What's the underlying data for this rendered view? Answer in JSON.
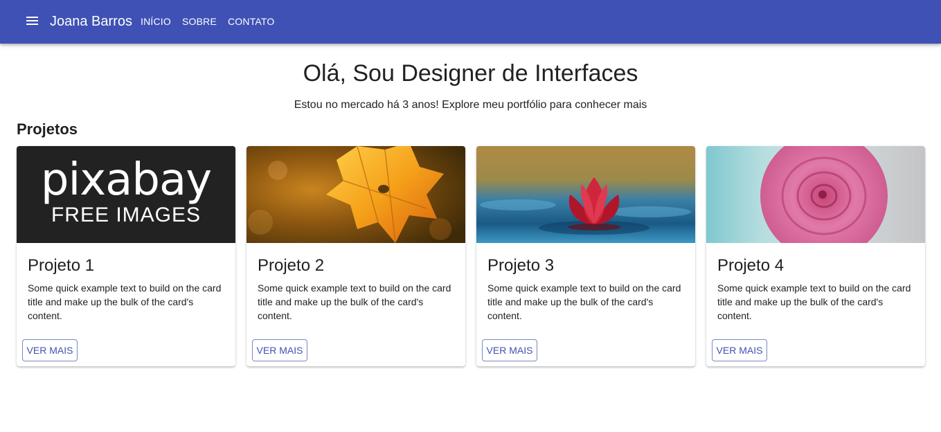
{
  "header": {
    "brand": "Joana Barros",
    "nav": [
      "INÍCIO",
      "SOBRE",
      "CONTATO"
    ]
  },
  "hero": {
    "title": "Olá, Sou Designer de Interfaces",
    "subtitle": "Estou no mercado há 3 anos! Explore meu portfólio para conhecer mais"
  },
  "projects": {
    "heading": "Projetos",
    "cards": [
      {
        "title": "Projeto 1",
        "text": "Some quick example text to build on the card title and make up the bulk of the card's content.",
        "button": "VER MAIS",
        "image": {
          "logo_word": "pixabay",
          "logo_sub": "FREE IMAGES"
        }
      },
      {
        "title": "Projeto 2",
        "text": "Some quick example text to build on the card title and make up the bulk of the card's content.",
        "button": "VER MAIS"
      },
      {
        "title": "Projeto 3",
        "text": "Some quick example text to build on the card title and make up the bulk of the card's content.",
        "button": "VER MAIS"
      },
      {
        "title": "Projeto 4",
        "text": "Some quick example text to build on the card title and make up the bulk of the card's content.",
        "button": "VER MAIS"
      }
    ]
  },
  "colors": {
    "appbar": "#3f51b5",
    "button_border": "#7986cb",
    "button_text": "#3f51b5"
  }
}
